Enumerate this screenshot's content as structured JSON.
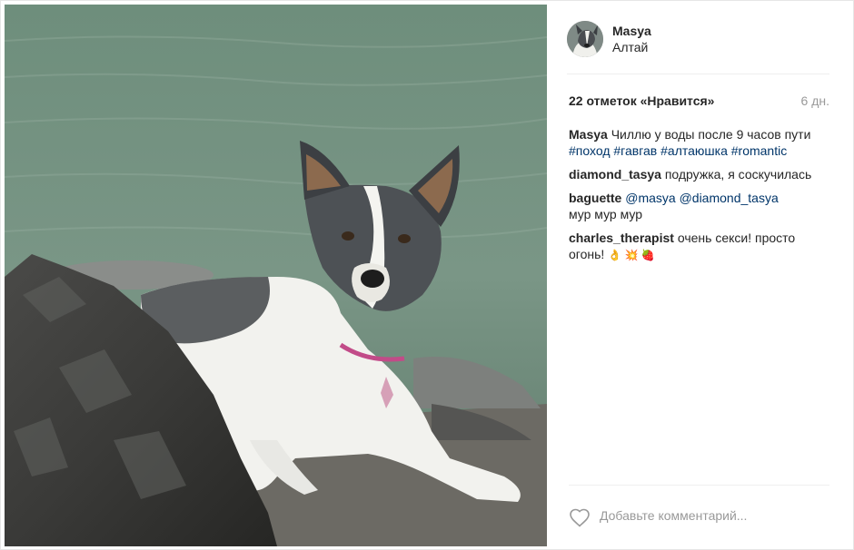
{
  "post": {
    "username": "Masya",
    "location": "Алтай",
    "likes_text": "22 отметок «Нравится»",
    "age": "6 дн."
  },
  "comments": [
    {
      "user": "Masya",
      "text": "Чиллю у воды после 9 часов пути",
      "hashtags": [
        "#поход",
        "#гавгав",
        "#алтаюшка",
        "#romantic"
      ]
    },
    {
      "user": "diamond_tasya",
      "text": "подружка, я соскучилась"
    },
    {
      "user": "baguette",
      "mentions": [
        "@masya",
        "@diamond_tasya"
      ],
      "text": "мур мур мур"
    },
    {
      "user": "charles_therapist",
      "text": "очень секси! просто огонь!",
      "emoji": "👌 💥 🍓"
    }
  ],
  "footer": {
    "comment_placeholder": "Добавьте комментарий..."
  },
  "icons": {
    "like": "heart-icon"
  },
  "colors": {
    "hashtag": "#003569",
    "muted": "#999999",
    "text": "#262626"
  }
}
